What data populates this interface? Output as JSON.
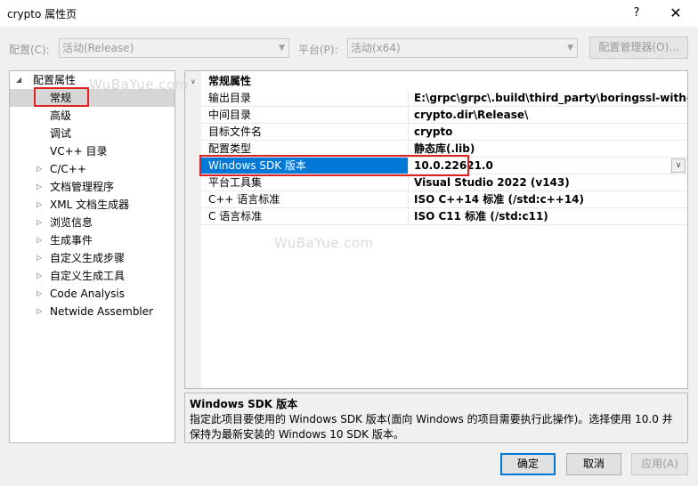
{
  "window": {
    "title": "crypto 属性页",
    "help_label": "?",
    "close_label": "✕"
  },
  "toolbar": {
    "config_label": "配置(C):",
    "config_value": "活动(Release)",
    "platform_label": "平台(P):",
    "platform_value": "活动(x64)",
    "config_manager_label": "配置管理器(O)..."
  },
  "tree": {
    "root": "配置属性",
    "items": [
      {
        "label": "常规",
        "expandable": false,
        "selected": true
      },
      {
        "label": "高级",
        "expandable": false
      },
      {
        "label": "调试",
        "expandable": false
      },
      {
        "label": "VC++ 目录",
        "expandable": false
      },
      {
        "label": "C/C++",
        "expandable": true
      },
      {
        "label": "文档管理程序",
        "expandable": true
      },
      {
        "label": "XML 文档生成器",
        "expandable": true
      },
      {
        "label": "浏览信息",
        "expandable": true
      },
      {
        "label": "生成事件",
        "expandable": true
      },
      {
        "label": "自定义生成步骤",
        "expandable": true
      },
      {
        "label": "自定义生成工具",
        "expandable": true
      },
      {
        "label": "Code Analysis",
        "expandable": true
      },
      {
        "label": "Netwide Assembler",
        "expandable": true
      }
    ]
  },
  "grid": {
    "section": "常规属性",
    "rows": [
      {
        "name": "输出目录",
        "value": "E:\\grpc\\grpc\\.build\\third_party\\boringssl-with-bazel\\"
      },
      {
        "name": "中间目录",
        "value": "crypto.dir\\Release\\"
      },
      {
        "name": "目标文件名",
        "value": "crypto"
      },
      {
        "name": "配置类型",
        "value": "静态库(.lib)"
      },
      {
        "name": "Windows SDK 版本",
        "value": "10.0.22621.0",
        "selected": true
      },
      {
        "name": "平台工具集",
        "value": "Visual Studio 2022 (v143)"
      },
      {
        "name": "C++ 语言标准",
        "value": "ISO C++14 标准 (/std:c++14)"
      },
      {
        "name": "C 语言标准",
        "value": "ISO C11 标准 (/std:c11)"
      }
    ]
  },
  "description": {
    "title": "Windows SDK 版本",
    "text": "指定此项目要使用的 Windows SDK 版本(面向 Windows 的项目需要执行此操作)。选择使用 10.0 并保持为最新安装的 Windows 10 SDK 版本。"
  },
  "buttons": {
    "ok": "确定",
    "cancel": "取消",
    "apply": "应用(A)"
  },
  "watermark": "WuBaYue.com",
  "colors": {
    "selection_blue": "#0078d7",
    "highlight_red": "#e02020"
  }
}
